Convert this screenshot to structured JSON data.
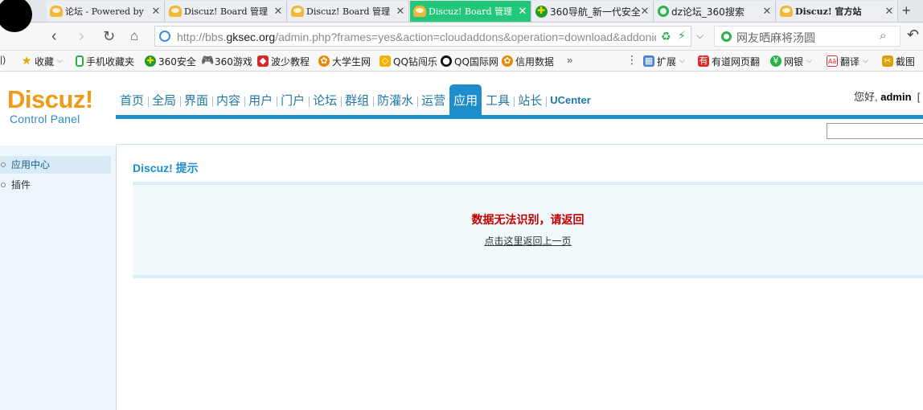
{
  "browser": {
    "tabs": [
      {
        "label": "论坛 - Powered by",
        "icon": "discuz-icon",
        "active": false
      },
      {
        "label": "Discuz! Board 管理",
        "icon": "discuz-icon",
        "active": false
      },
      {
        "label": "Discuz! Board 管理",
        "icon": "discuz-icon",
        "active": false
      },
      {
        "label": "Discuz! Board 管理",
        "icon": "discuz-icon",
        "active": true
      },
      {
        "label": "360导航_新一代安全",
        "icon": "nav360-icon",
        "active": false
      },
      {
        "label": "dz论坛_360搜索",
        "icon": "search360-icon",
        "active": false
      },
      {
        "label": "Discuz! 官方站",
        "icon": "discuz-icon",
        "active": false
      }
    ],
    "new_tab": "+",
    "url_prefix": "http://bbs.",
    "url_domain": "gksec.org",
    "url_suffix": "/admin.php?frames=yes&action=cloudaddons&operation=download&addonids=",
    "search_text": "网友晒麻将汤圆",
    "bookmarks": [
      {
        "label": "收藏",
        "icon": "star-icon",
        "dropdown": true
      },
      {
        "label": "手机收藏夹",
        "icon": "phone-icon"
      },
      {
        "label": "360安全",
        "icon": "shield360-icon"
      },
      {
        "label": "360游戏",
        "icon": "gamepad-icon"
      },
      {
        "label": "波少教程",
        "icon": "bosha-icon"
      },
      {
        "label": "大学生网",
        "icon": "college-icon"
      },
      {
        "label": "QQ钻闯乐",
        "icon": "qq-diamond-icon"
      },
      {
        "label": "QQ国际网",
        "icon": "qq-icon"
      },
      {
        "label": "信用数据",
        "icon": "credit-icon"
      }
    ],
    "more": "»",
    "extensions": [
      {
        "label": "扩展",
        "icon": "puzzle-icon",
        "dropdown": true
      },
      {
        "label": "有道网页翻",
        "icon": "youdao-icon"
      },
      {
        "label": "网银",
        "icon": "bank-icon",
        "dropdown": true
      },
      {
        "label": "翻译",
        "icon": "translate-icon",
        "dropdown": true
      },
      {
        "label": "截图",
        "icon": "screenshot-icon"
      }
    ]
  },
  "header": {
    "logo_main": "Discuz!",
    "logo_sub": "Control Panel",
    "nav": [
      "首页",
      "全局",
      "界面",
      "内容",
      "用户",
      "门户",
      "论坛",
      "群组",
      "防灌水",
      "运营",
      "应用",
      "工具",
      "站长",
      "UCenter"
    ],
    "active_nav": "应用",
    "greeting": "您好,",
    "username": "admin",
    "greeting_tail": "["
  },
  "sidebar": {
    "items": [
      {
        "label": "应用中心",
        "current": true
      },
      {
        "label": "插件",
        "current": false
      }
    ]
  },
  "main": {
    "title": "Discuz! 提示",
    "message": "数据无法识别，请返回",
    "back_link": "点击这里返回上一页"
  }
}
